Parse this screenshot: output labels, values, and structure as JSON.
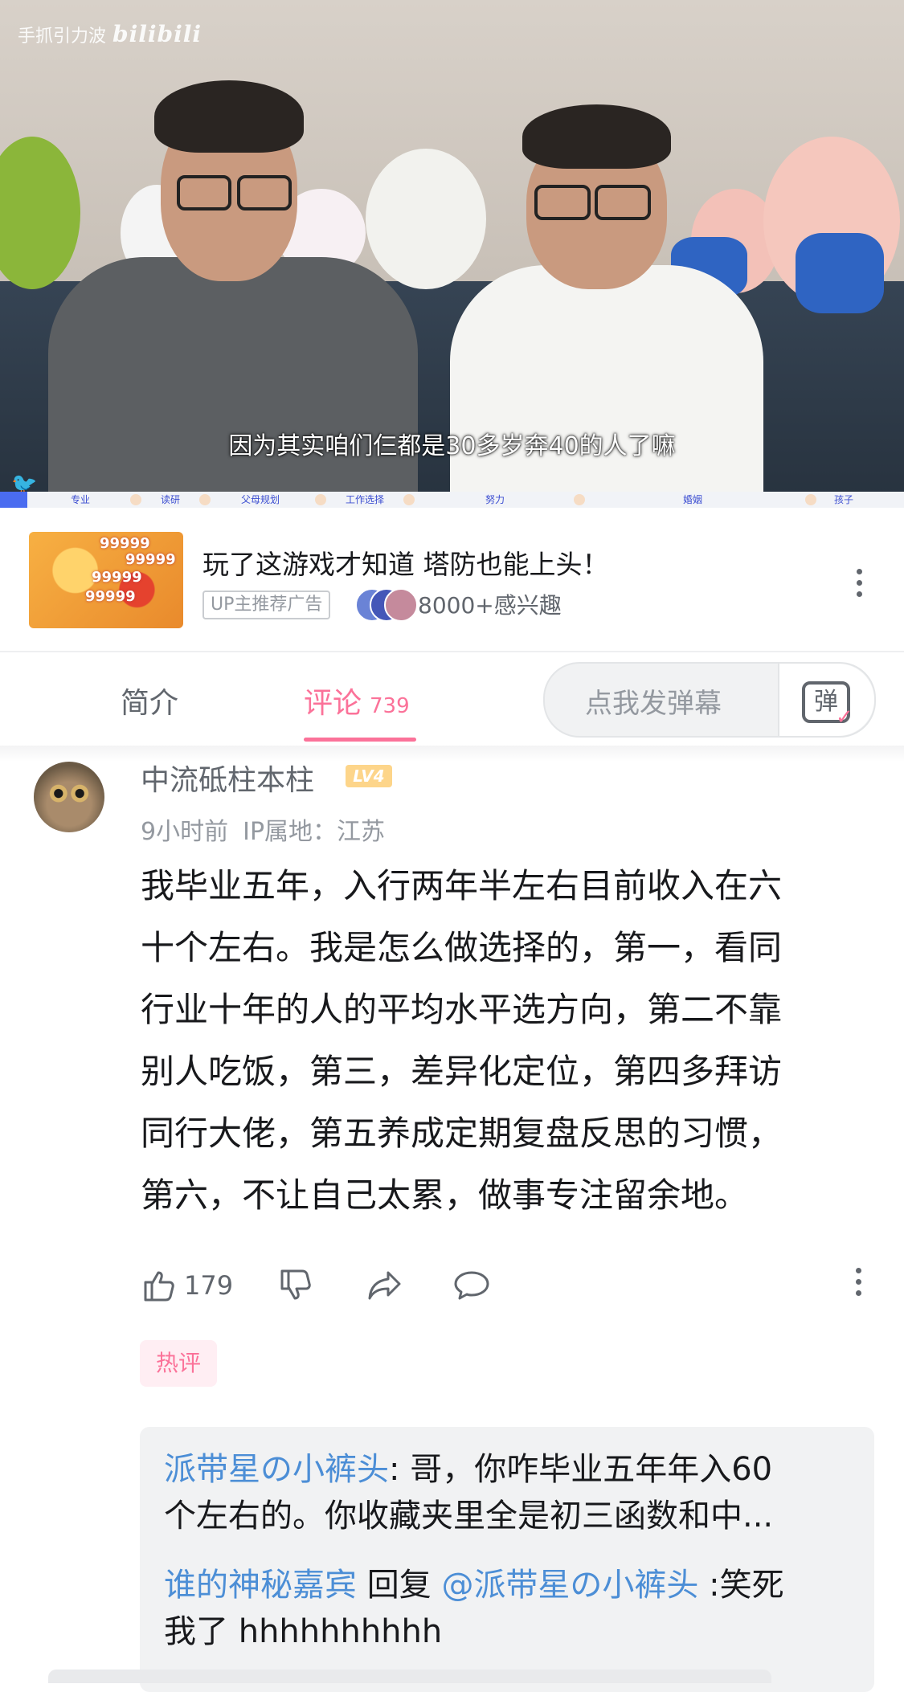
{
  "video": {
    "watermark_text": "手抓引力波",
    "watermark_logo": "bilibili",
    "subtitle": "因为其实咱们仨都是30多岁奔40的人了嘛",
    "chapters": [
      "专业",
      "读研",
      "父母规划",
      "工作选择",
      "努力",
      "婚姻",
      "孩子"
    ],
    "progress_color": "#4a6cf0"
  },
  "ad": {
    "title": "玩了这游戏才知道 塔防也能上头！",
    "tag": "UP主推荐广告",
    "interest": "8000+感兴趣",
    "thumb_text": [
      "99999",
      "99999",
      "99999",
      "99999"
    ]
  },
  "tabs": {
    "intro": "简介",
    "comments": "评论",
    "comments_count": "739",
    "danmu_placeholder": "点我发弹幕",
    "danmu_icon": "弹",
    "accent": "#fb7299"
  },
  "comment": {
    "username": "中流砥柱本柱",
    "level": "LV4",
    "time": "9小时前",
    "ip": "IP属地：江苏",
    "lines": [
      "我毕业五年，入行两年半左右目前收入在六",
      "十个左右。我是怎么做选择的，第一，看同",
      "行业十年的人的平均水平选方向，第二不靠",
      "别人吃饭，第三，差异化定位，第四多拜访",
      "同行大佬，第五养成定期复盘反思的习惯，",
      "第六，不让自己太累，做事专注留余地。"
    ],
    "likes": "179",
    "badge": "热评"
  },
  "replies": [
    {
      "name": "派带星の小裤头",
      "line1": ": 哥，你咋毕业五年年入60",
      "line2": "个左右的。你收藏夹里全是初三函数和中..."
    },
    {
      "name": "谁的神秘嘉宾",
      "reply_word": " 回复 ",
      "target": "@派带星の小裤头",
      "line1": " :笑死",
      "line2": "我了 hhhhhhhhhh"
    }
  ]
}
